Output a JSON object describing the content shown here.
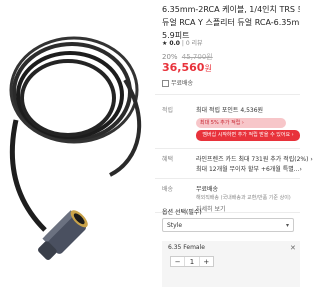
{
  "product": {
    "title_lines": [
      "6.35mm-2RCA 케이블, 1/4인치 TRS 모노",
      "듀얼 RCA Y 스플리터 듀얼 RCA-6.35mm 어",
      "5.9피트"
    ],
    "rating_star": "★",
    "rating_score": "0.0",
    "review_count": "0 리뷰",
    "discount": "20%",
    "original_price": "45,700원",
    "sale_price": "36,560",
    "currency": "원",
    "free_shipping_badge": "무료배송"
  },
  "details": {
    "point_label": "적립",
    "point_value": "최대 적립 포인트 4,536원",
    "red_btn": "최대 5% 추가 적립 ›",
    "dark_btn": "멤버십 시작하면 추가 적립 받을 수 있어요 ›",
    "benefit_label": "혜택",
    "benefit_line1": "라인프렌즈 카드 최대 731원 추가 적립(2%) ›",
    "benefit_line2": "최대 12개월 무이자 할부 +6개월 특별...›",
    "shipping_label": "배송",
    "shipping_line1": "무료배송",
    "shipping_line2": "해외직배송 (국내배송과 교환/반품 기준 상이)",
    "shipping_link": "자세히 보기"
  },
  "options": {
    "title": "옵션 선택(필수)",
    "style_select": "Style",
    "size_select": "6.35 Female"
  },
  "selected": {
    "minus": "−",
    "qty": "1",
    "plus": "+",
    "close": "✕"
  }
}
